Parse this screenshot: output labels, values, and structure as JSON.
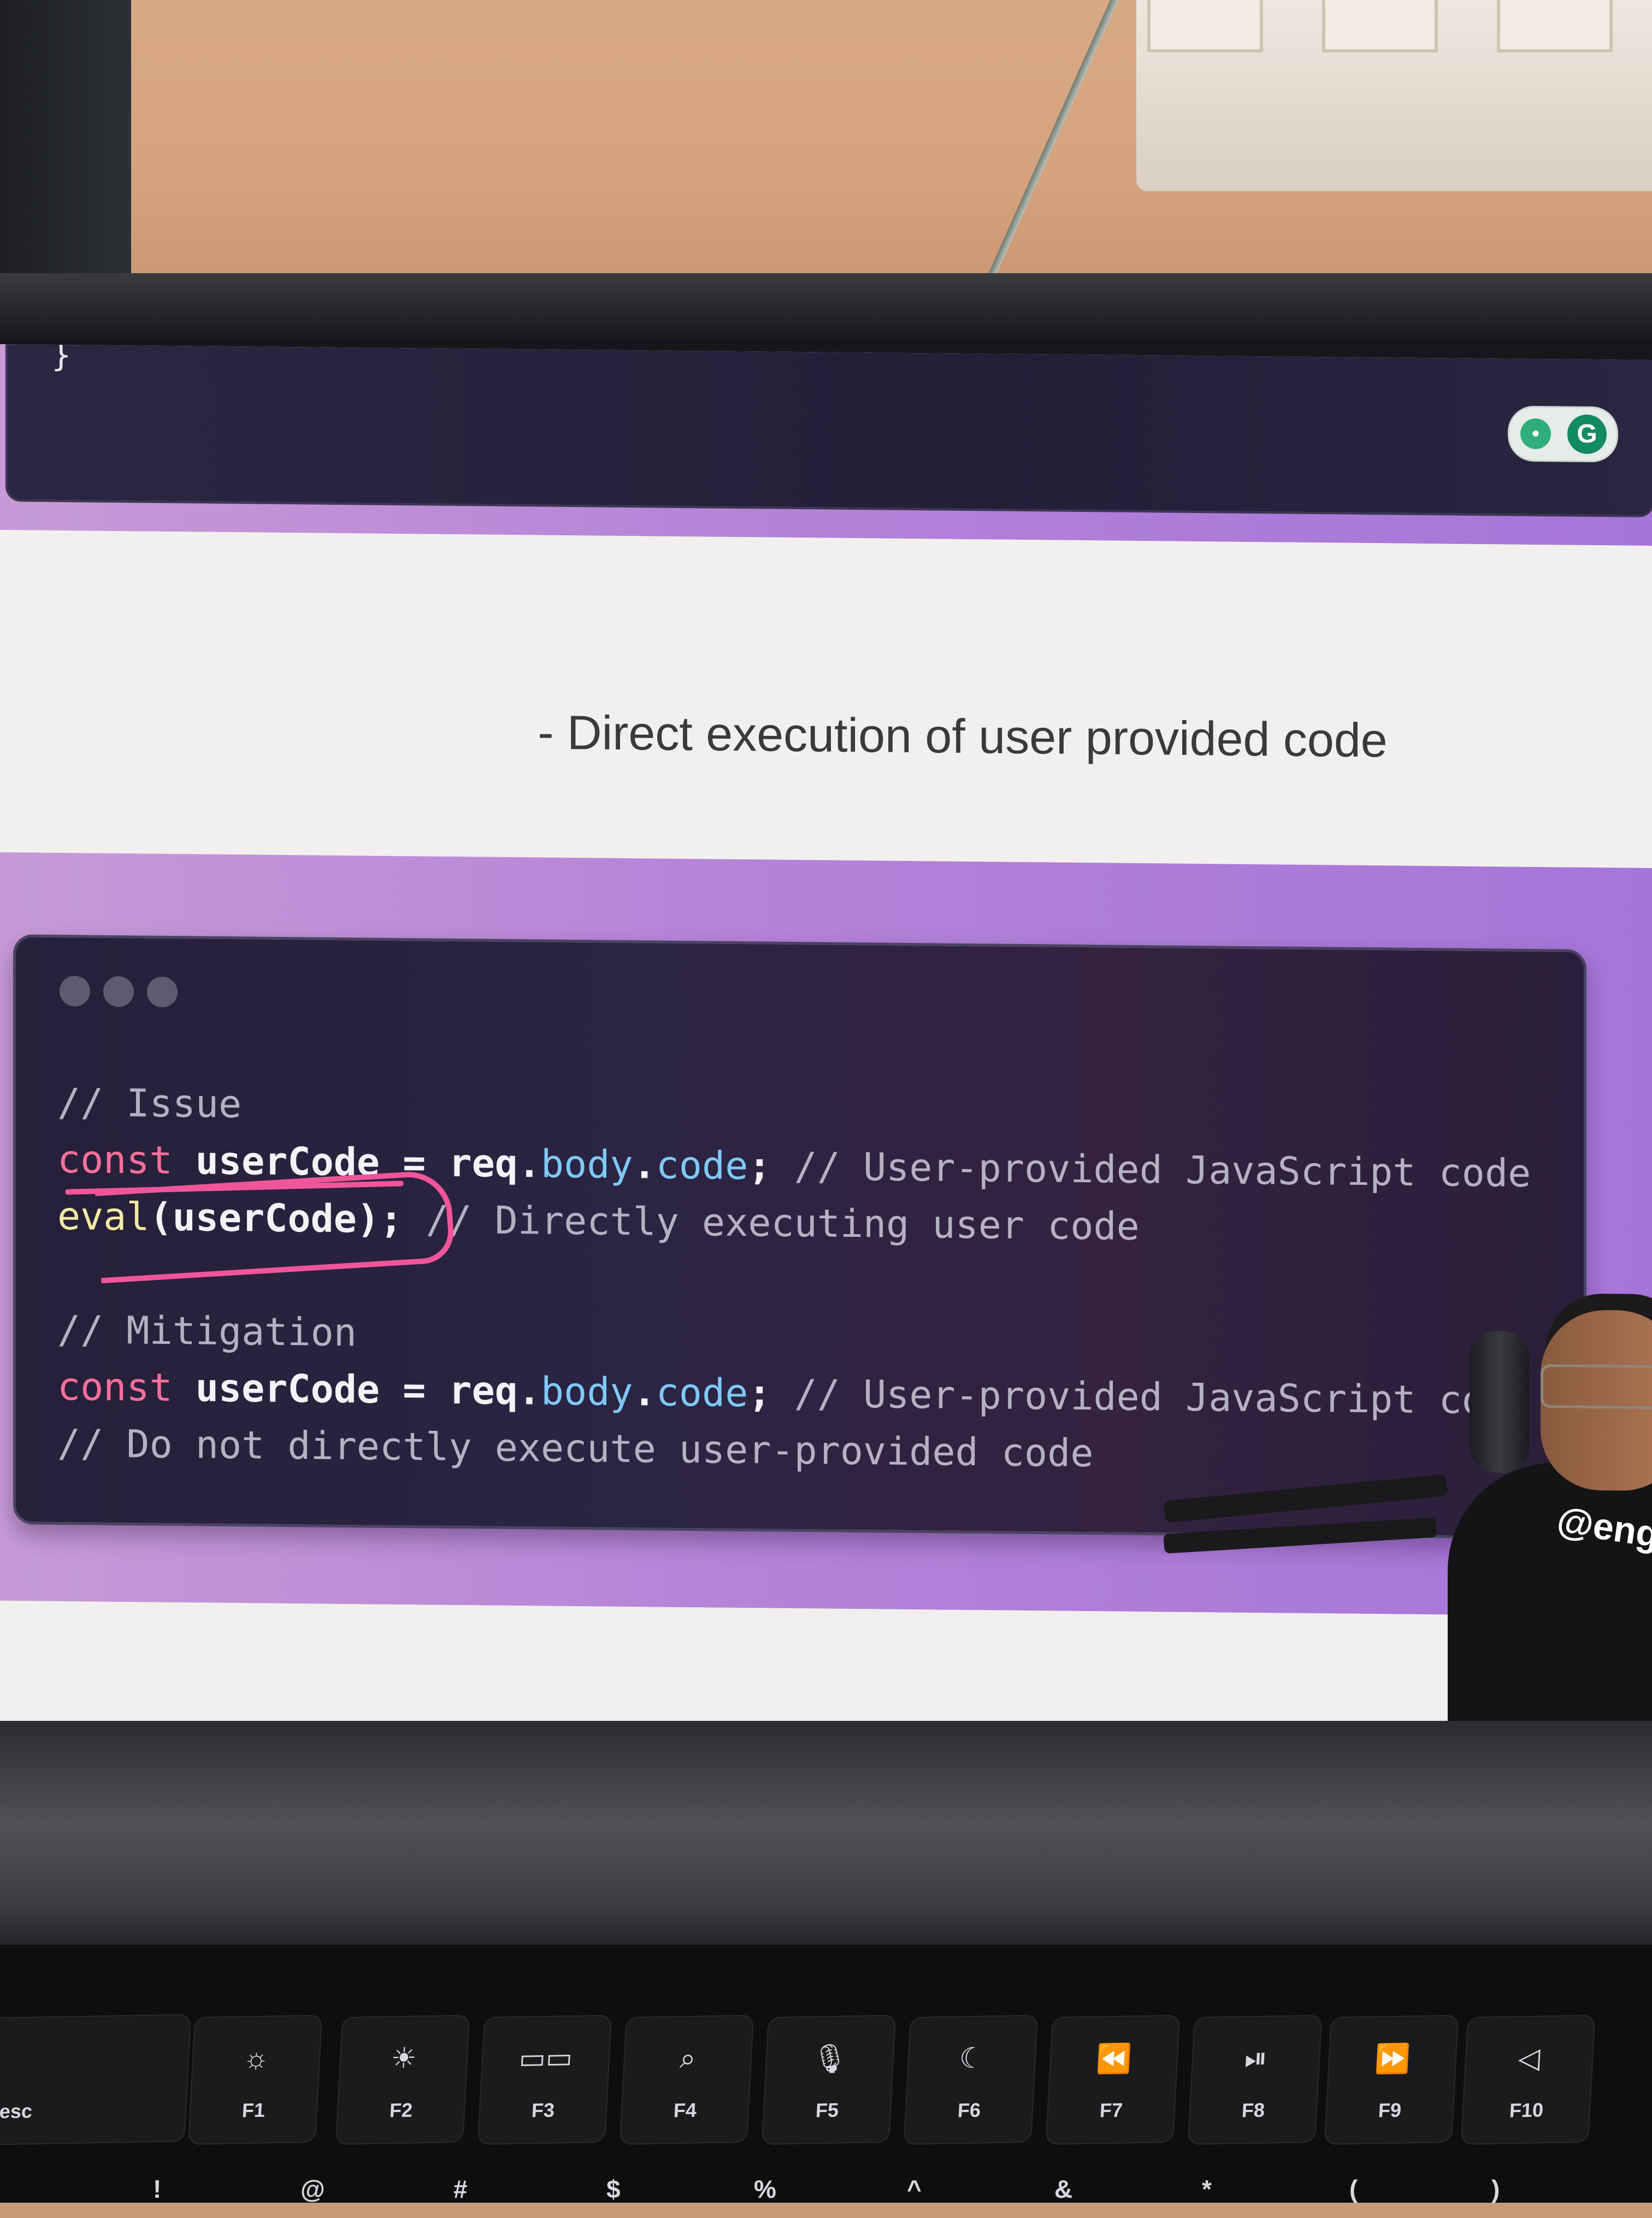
{
  "environment": {
    "accent_purple": "#b583d8",
    "ink_color": "#f0559a"
  },
  "top_card": {
    "brace_text": "}"
  },
  "extension": {
    "icon_left": "lightbulb-icon",
    "icon_right": "grammarly-icon",
    "icon_right_letter": "G"
  },
  "slide": {
    "heading": "- Direct execution of user provided code"
  },
  "code_window": {
    "lines": [
      [
        {
          "t": "// Issue",
          "c": "comment"
        }
      ],
      [
        {
          "t": "const",
          "c": "kw"
        },
        {
          "t": " userCode = ",
          "c": "plain"
        },
        {
          "t": "req.",
          "c": "plain"
        },
        {
          "t": "body",
          "c": "prop"
        },
        {
          "t": ".",
          "c": "plain"
        },
        {
          "t": "code",
          "c": "prop"
        },
        {
          "t": "; ",
          "c": "plain"
        },
        {
          "t": "// User-provided JavaScript code",
          "c": "comment"
        }
      ],
      [
        {
          "t": "eval",
          "c": "fn"
        },
        {
          "t": "(userCode); ",
          "c": "plain"
        },
        {
          "t": "// Directly executing user code",
          "c": "comment"
        }
      ],
      [
        {
          "t": "",
          "c": "plain"
        }
      ],
      [
        {
          "t": "// Mitigation",
          "c": "comment"
        }
      ],
      [
        {
          "t": "const",
          "c": "kw"
        },
        {
          "t": " userCode = ",
          "c": "plain"
        },
        {
          "t": "req.",
          "c": "plain"
        },
        {
          "t": "body",
          "c": "prop"
        },
        {
          "t": ".",
          "c": "plain"
        },
        {
          "t": "code",
          "c": "prop"
        },
        {
          "t": "; ",
          "c": "plain"
        },
        {
          "t": "// User-provided JavaScript co",
          "c": "comment"
        }
      ],
      [
        {
          "t": "// Do not directly execute user-provided code",
          "c": "comment"
        }
      ]
    ]
  },
  "presenter": {
    "shirt_text": "@engi"
  },
  "keyboard": {
    "function_keys": [
      {
        "label": "esc",
        "icon": ""
      },
      {
        "label": "F1",
        "icon": "☼"
      },
      {
        "label": "F2",
        "icon": "☀"
      },
      {
        "label": "F3",
        "icon": "▭▭"
      },
      {
        "label": "F4",
        "icon": "⌕"
      },
      {
        "label": "F5",
        "icon": "🎙"
      },
      {
        "label": "F6",
        "icon": "☾"
      },
      {
        "label": "F7",
        "icon": "⏪"
      },
      {
        "label": "F8",
        "icon": "⏯"
      },
      {
        "label": "F9",
        "icon": "⏩"
      },
      {
        "label": "F10",
        "icon": "◁"
      }
    ],
    "number_row": [
      "!",
      "@",
      "#",
      "$",
      "%",
      "^",
      "&",
      "*",
      "(",
      ")"
    ]
  }
}
